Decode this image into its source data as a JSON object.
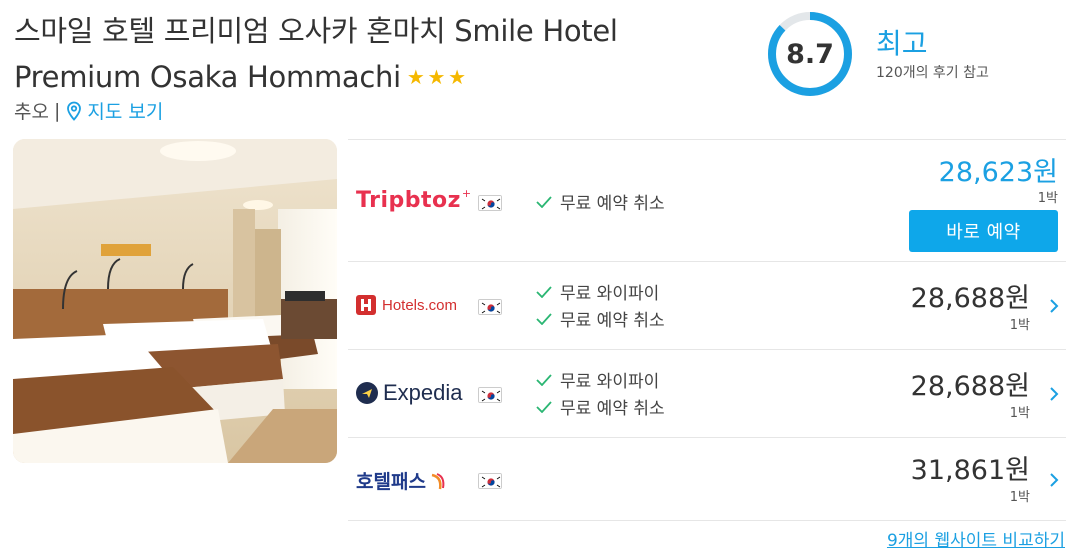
{
  "hotel": {
    "name_line1": "스마일 호텔 프리미엄 오사카 혼마치 Smile Hotel",
    "name_line2": "Premium Osaka Hommachi",
    "star_count": 3,
    "area": "추오",
    "separator": "|",
    "map_link": "지도 보기"
  },
  "rating": {
    "score": "8.7",
    "score_fraction": 0.87,
    "label": "최고",
    "reviews": "120개의 후기 참고"
  },
  "offers": [
    {
      "partner": "Tripbtoz",
      "flag": "KR",
      "features": [
        "무료 예약 취소"
      ],
      "price": "28,623원",
      "per_night": "1박",
      "button_label": "바로 예약"
    },
    {
      "partner": "Hotels.com",
      "flag": "KR",
      "features": [
        "무료 와이파이",
        "무료 예약 취소"
      ],
      "price": "28,688원",
      "per_night": "1박"
    },
    {
      "partner": "Expedia",
      "flag": "KR",
      "features": [
        "무료 와이파이",
        "무료 예약 취소"
      ],
      "price": "28,688원",
      "per_night": "1박"
    },
    {
      "partner": "호텔패스",
      "flag": "KR",
      "features": [],
      "price": "31,861원",
      "per_night": "1박"
    }
  ],
  "compare_link": "9개의 웹사이트 비교하기",
  "colors": {
    "accent": "#1ba0e2",
    "button": "#0ea7ea",
    "star": "#f5b800",
    "check": "#2bb673",
    "tripbtoz": "#e8314f",
    "hotels_com": "#d32f2f",
    "expedia": "#1f2d4f"
  },
  "icons": {
    "map": "map-pin-icon",
    "check": "check-icon",
    "chevron": "chevron-right-icon",
    "star": "star-icon"
  }
}
